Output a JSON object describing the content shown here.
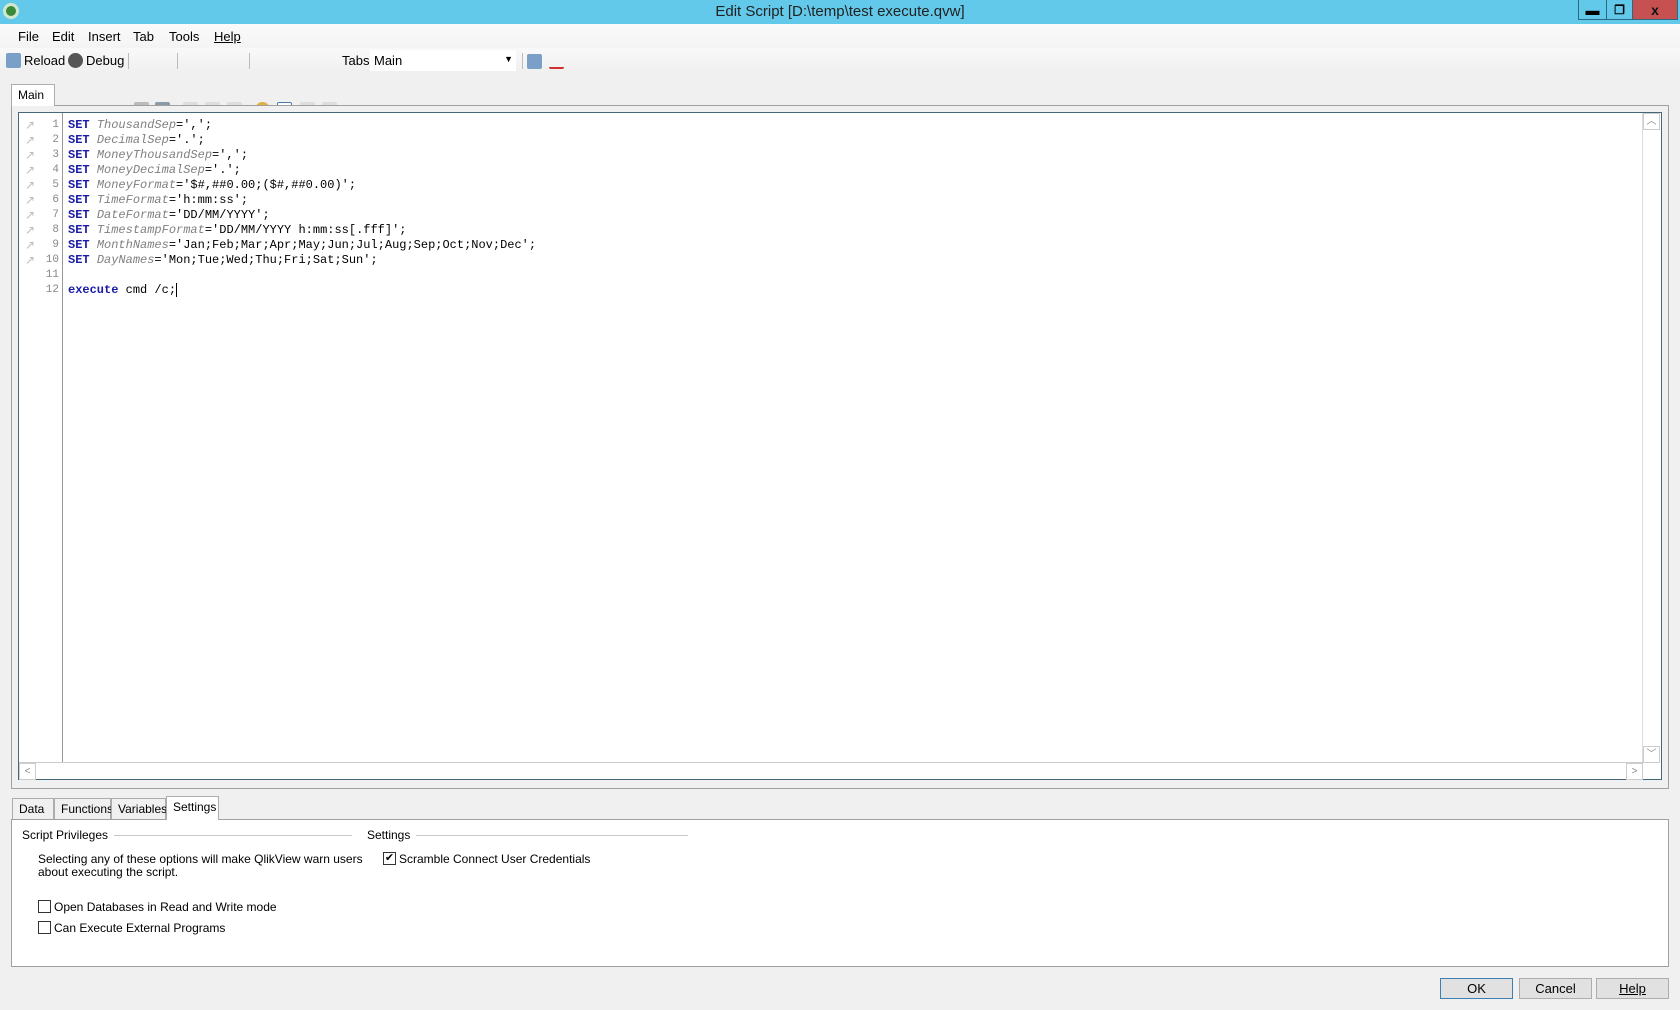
{
  "window": {
    "title": "Edit Script [D:\\temp\\test execute.qvw]",
    "minimize": "▬",
    "restore": "❐",
    "close": "x"
  },
  "menu": [
    "File",
    "Edit",
    "Insert",
    "Tab",
    "Tools",
    "Help"
  ],
  "toolbar": {
    "reload": "Reload",
    "debug": "Debug",
    "tabs_label": "Tabs",
    "tab_selected": "Main"
  },
  "script_tabs": [
    "Main"
  ],
  "script_lines": [
    {
      "n": "1",
      "kw": "SET",
      "var": "ThousandSep",
      "val": "=',';"
    },
    {
      "n": "2",
      "kw": "SET",
      "var": "DecimalSep",
      "val": "='.';"
    },
    {
      "n": "3",
      "kw": "SET",
      "var": "MoneyThousandSep",
      "val": "=',';"
    },
    {
      "n": "4",
      "kw": "SET",
      "var": "MoneyDecimalSep",
      "val": "='.';"
    },
    {
      "n": "5",
      "kw": "SET",
      "var": "MoneyFormat",
      "val": "='$#,##0.00;($#,##0.00)';"
    },
    {
      "n": "6",
      "kw": "SET",
      "var": "TimeFormat",
      "val": "='h:mm:ss';"
    },
    {
      "n": "7",
      "kw": "SET",
      "var": "DateFormat",
      "val": "='DD/MM/YYYY';"
    },
    {
      "n": "8",
      "kw": "SET",
      "var": "TimestampFormat",
      "val": "='DD/MM/YYYY h:mm:ss[.fff]';"
    },
    {
      "n": "9",
      "kw": "SET",
      "var": "MonthNames",
      "val": "='Jan;Feb;Mar;Apr;May;Jun;Jul;Aug;Sep;Oct;Nov;Dec';"
    },
    {
      "n": "10",
      "kw": "SET",
      "var": "DayNames",
      "val": "='Mon;Tue;Wed;Thu;Fri;Sat;Sun';"
    },
    {
      "n": "11",
      "kw": "",
      "var": "",
      "val": ""
    },
    {
      "n": "12",
      "kw": "execute",
      "var": "",
      "val": " cmd /c;"
    }
  ],
  "bottom_tabs": [
    "Data",
    "Functions",
    "Variables",
    "Settings"
  ],
  "settings": {
    "privileges_title": "Script Privileges",
    "privileges_note_1": "Selecting any of these options will make QlikView warn users",
    "privileges_note_2": "about executing the script.",
    "open_db_rw": "Open Databases in Read and Write mode",
    "can_execute": "Can Execute External Programs",
    "settings_title": "Settings",
    "scramble": "Scramble Connect User Credentials",
    "open_db_rw_checked": false,
    "can_execute_checked": false,
    "scramble_checked": true
  },
  "buttons": {
    "ok": "OK",
    "cancel": "Cancel",
    "help": "Help"
  }
}
